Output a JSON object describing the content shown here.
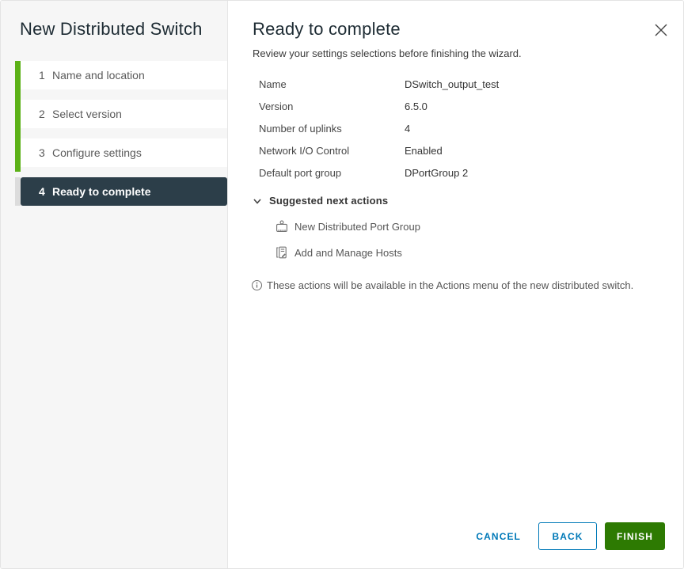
{
  "window": {
    "title": "New Distributed Switch"
  },
  "sidebar": {
    "steps": [
      {
        "num": "1",
        "label": "Name and location"
      },
      {
        "num": "2",
        "label": "Select version"
      },
      {
        "num": "3",
        "label": "Configure settings"
      },
      {
        "num": "4",
        "label": "Ready to complete"
      }
    ],
    "active_step": "4"
  },
  "panel": {
    "title": "Ready to complete",
    "subtitle": "Review your settings selections before finishing the wizard.",
    "settings": [
      {
        "label": "Name",
        "value": "DSwitch_output_test"
      },
      {
        "label": "Version",
        "value": "6.5.0"
      },
      {
        "label": "Number of uplinks",
        "value": "4"
      },
      {
        "label": "Network I/O Control",
        "value": "Enabled"
      },
      {
        "label": "Default port group",
        "value": "DPortGroup 2"
      }
    ],
    "suggested": {
      "header": "Suggested next actions",
      "items": [
        {
          "label": "New Distributed Port Group",
          "icon": "port-group-icon"
        },
        {
          "label": "Add and Manage Hosts",
          "icon": "hosts-edit-icon"
        }
      ]
    },
    "note": "These actions will be available in the Actions menu of the new distributed switch.",
    "buttons": {
      "cancel": "CANCEL",
      "back": "BACK",
      "finish": "FINISH"
    }
  },
  "colors": {
    "accent_blue": "#0079b8",
    "finish_green": "#2d7a02",
    "progress_green": "#5cb117",
    "active_step_bg": "#2c3e49"
  }
}
